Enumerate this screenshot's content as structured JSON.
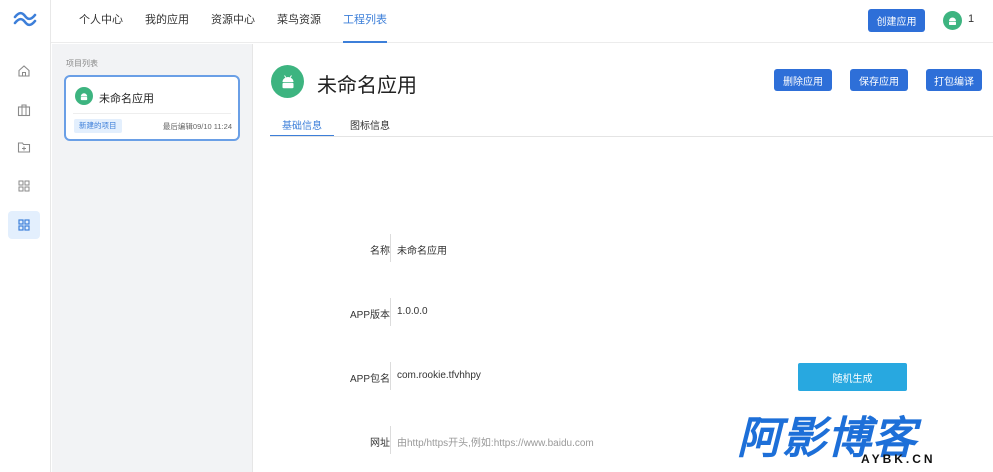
{
  "topnav": {
    "tabs": [
      {
        "label": "个人中心"
      },
      {
        "label": "我的应用"
      },
      {
        "label": "资源中心"
      },
      {
        "label": "菜鸟资源"
      },
      {
        "label": "工程列表",
        "active": true
      }
    ],
    "create_button": "创建应用",
    "user_count": "1"
  },
  "sidebar": {
    "icons": [
      "home-icon",
      "briefcase-icon",
      "folder-add-icon",
      "grid-icon",
      "grid-active-icon"
    ]
  },
  "project_panel": {
    "title": "项目列表",
    "card": {
      "name": "未命名应用",
      "badge": "新建的项目",
      "last_edit": "最后编辑09/10 11:24"
    }
  },
  "main": {
    "app_title": "未命名应用",
    "buttons": {
      "delete": "删除应用",
      "save": "保存应用",
      "build": "打包编译"
    },
    "tabs": [
      {
        "label": "基础信息",
        "active": true
      },
      {
        "label": "图标信息"
      }
    ],
    "fields": {
      "name_label": "名称",
      "name_value": "未命名应用",
      "version_label": "APP版本",
      "version_value": "1.0.0.0",
      "package_label": "APP包名",
      "package_value": "com.rookie.tfvhhpy",
      "random_button": "随机生成",
      "url_label": "网址",
      "url_placeholder": "由http/https开头,例如:https://www.baidu.com"
    }
  },
  "watermark": {
    "cn": "阿影博客",
    "en": "AYBK.CN"
  },
  "colors": {
    "primary": "#2e6fd8",
    "accent_tab": "#3d7fd9",
    "android_green": "#3db480",
    "random_button": "#28a8e0",
    "panel_bg": "#f2f3f5"
  }
}
